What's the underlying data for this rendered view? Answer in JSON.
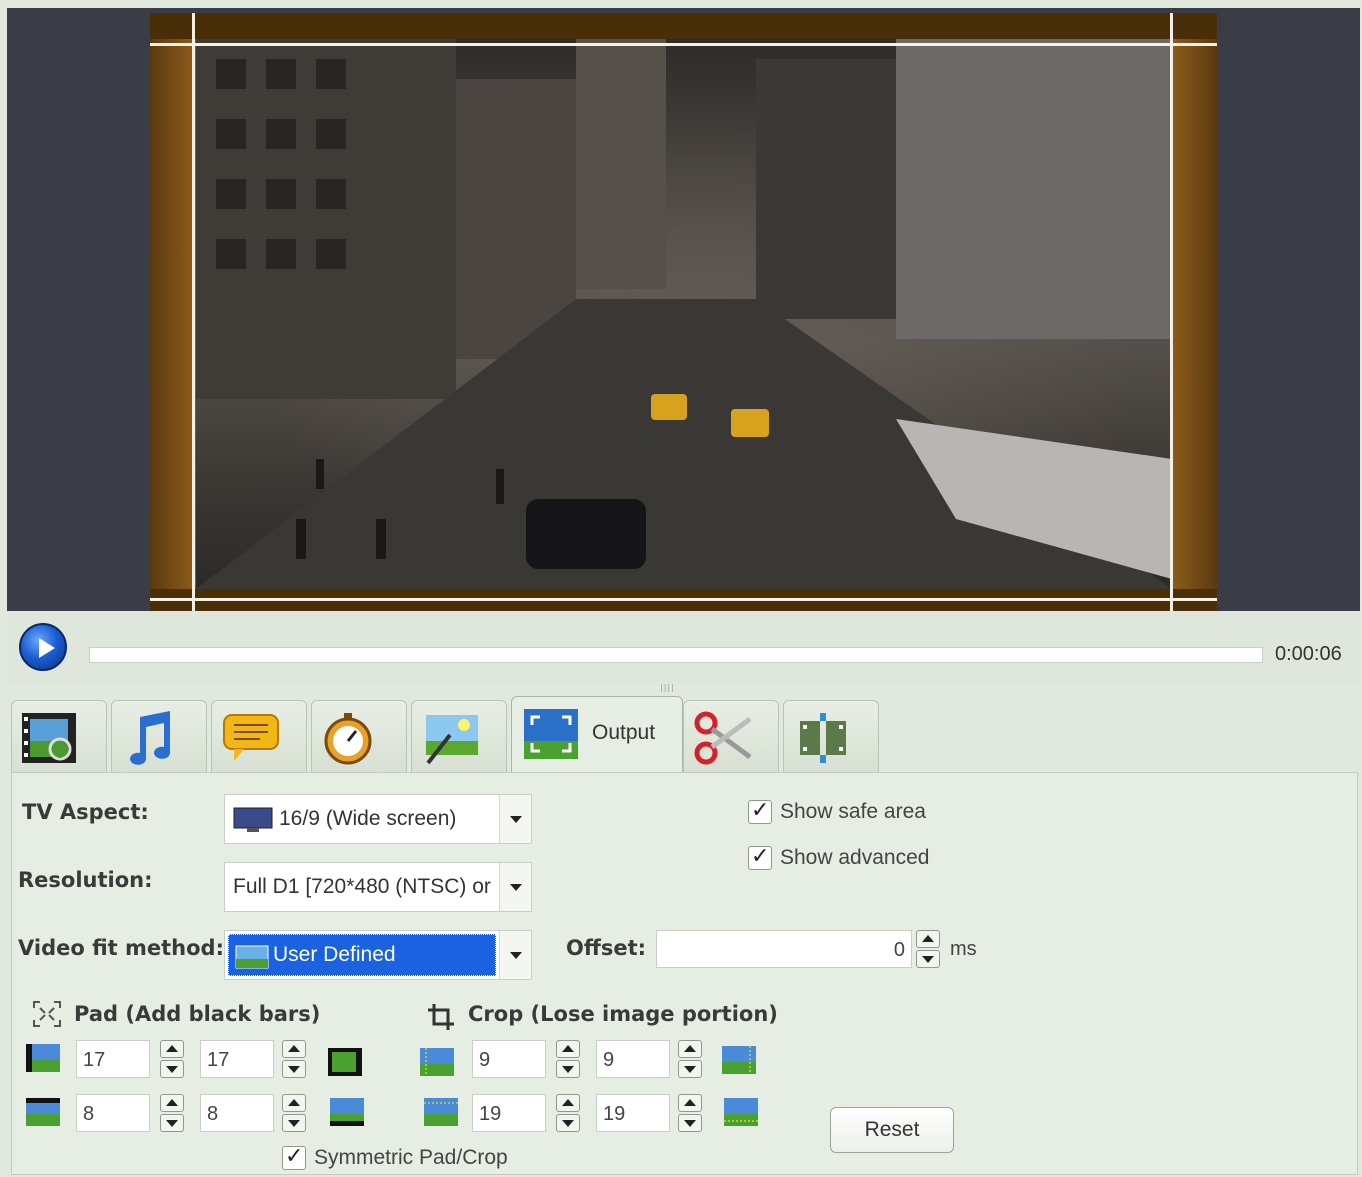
{
  "preview": {
    "image_alt": "City street with taxis (video preview)",
    "frame_color": "#6b4511"
  },
  "transport": {
    "timecode": "0:00:06",
    "progress": 0.0
  },
  "tabs": [
    {
      "icon": "film-video-icon",
      "label": ""
    },
    {
      "icon": "music-note-icon",
      "label": ""
    },
    {
      "icon": "subtitle-speech-icon",
      "label": ""
    },
    {
      "icon": "stopwatch-icon",
      "label": ""
    },
    {
      "icon": "image-effects-icon",
      "label": ""
    },
    {
      "icon": "output-resize-icon",
      "label": "Output"
    },
    {
      "icon": "scissors-icon",
      "label": ""
    },
    {
      "icon": "join-clips-icon",
      "label": ""
    }
  ],
  "output": {
    "tv_aspect_label": "TV Aspect:",
    "tv_aspect_value": "16/9 (Wide screen)",
    "resolution_label": "Resolution:",
    "resolution_value": "Full D1 [720*480 (NTSC) or",
    "fit_method_label": "Video fit method:",
    "fit_method_value": "User Defined",
    "offset_label": "Offset:",
    "offset_value": "0",
    "offset_unit": "ms",
    "show_safe_area": "Show safe area",
    "show_advanced": "Show advanced",
    "pad_title": "Pad (Add black bars)",
    "crop_title": "Crop (Lose image portion)",
    "pad": {
      "left": "17",
      "right": "17",
      "top": "8",
      "bottom": "8"
    },
    "crop": {
      "left": "9",
      "right": "9",
      "top": "19",
      "bottom": "19"
    },
    "symmetric": "Symmetric Pad/Crop",
    "reset": "Reset"
  },
  "colors": {
    "accent": "#1a62e0",
    "panel": "#e6ede2"
  }
}
